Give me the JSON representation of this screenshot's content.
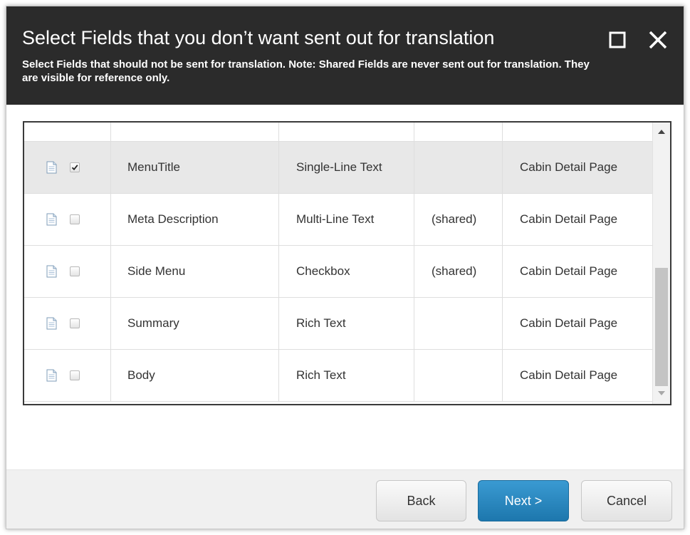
{
  "dialog": {
    "title": "Select Fields that you don’t want sent out for translation",
    "subtitle": "Select Fields that should not be sent for translation. Note: Shared Fields are never sent out for translation. They are visible for reference only.",
    "window_buttons": {
      "maximize_icon": "maximize-icon",
      "close_icon": "close-icon"
    }
  },
  "grid": {
    "rows": [
      {
        "checked": false,
        "name": "",
        "type": "",
        "shared": "",
        "template": "",
        "partial": true
      },
      {
        "checked": true,
        "name": "MenuTitle",
        "type": "Single-Line Text",
        "shared": "",
        "template": "Cabin Detail Page",
        "selected": true
      },
      {
        "checked": false,
        "name": "Meta Description",
        "type": "Multi-Line Text",
        "shared": "(shared)",
        "template": "Cabin Detail Page"
      },
      {
        "checked": false,
        "name": "Side Menu",
        "type": "Checkbox",
        "shared": "(shared)",
        "template": "Cabin Detail Page"
      },
      {
        "checked": false,
        "name": "Summary",
        "type": "Rich Text",
        "shared": "",
        "template": "Cabin Detail Page"
      },
      {
        "checked": false,
        "name": "Body",
        "type": "Rich Text",
        "shared": "",
        "template": "Cabin Detail Page"
      }
    ],
    "row_icon": "document-icon",
    "scroll_position": 0.8
  },
  "footer": {
    "back_label": "Back",
    "next_label": "Next >",
    "cancel_label": "Cancel"
  },
  "colors": {
    "header_bg": "#2b2b2b",
    "primary_button": "#2384be",
    "selected_row": "#e8e8e8"
  }
}
